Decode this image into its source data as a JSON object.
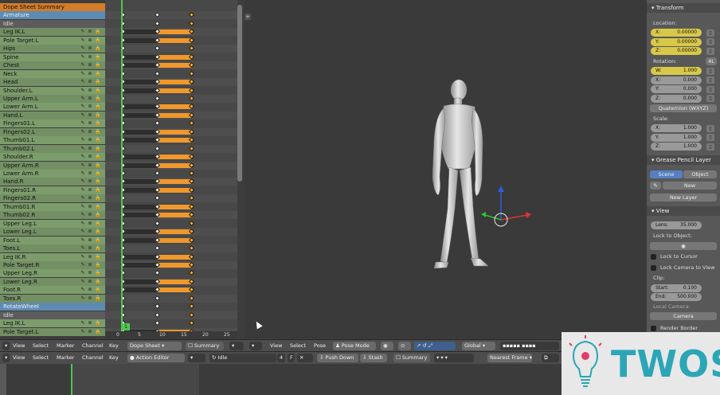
{
  "dopesheet": {
    "summary_label": "Dope Sheet Summary",
    "group_label": "Armature",
    "action1": "Idle",
    "action2": "Idle",
    "group2_label": "RotateWheel",
    "bones1": [
      "Leg IK.L",
      "Pole Target.L",
      "Hips",
      "Spine",
      "Chest",
      "Neck",
      "Head",
      "Shoulder.L",
      "Upper Arm.L",
      "Lower Arm.L",
      "Hand.L",
      "Fingers01.L",
      "Fingers02.L",
      "Thumb01.L",
      "Thumb02.L",
      "Shoulder.R",
      "Upper Arm.R",
      "Lower Arm.R",
      "Hand.R",
      "Fingers01.R",
      "Fingers02.R",
      "Thumb01.R",
      "Thumb02.R",
      "Upper Leg.L",
      "Lower Leg.L",
      "Foot.L",
      "Toes.L",
      "Leg IK.R",
      "Pole Target.R",
      "Upper Leg.R",
      "Lower Leg.R",
      "Foot.R",
      "Toes.R"
    ],
    "bones2": [
      "Leg IK.L",
      "Pole Target.L"
    ],
    "ruler": [
      "0",
      "5",
      "10",
      "15",
      "20",
      "25"
    ],
    "current_frame": "1"
  },
  "properties": {
    "transform_header": "Transform",
    "location_label": "Location:",
    "location": [
      {
        "k": "X:",
        "v": "0.00000"
      },
      {
        "k": "Y:",
        "v": "0.00000"
      },
      {
        "k": "Z:",
        "v": "0.00000"
      }
    ],
    "rotation_label": "Rotation:",
    "rotation_badge": "4L",
    "rotation": [
      {
        "k": "W:",
        "v": "1.000"
      },
      {
        "k": "X:",
        "v": "0.000"
      },
      {
        "k": "Y:",
        "v": "0.000"
      },
      {
        "k": "Z:",
        "v": "0.000"
      }
    ],
    "rotation_mode": "Quaternion (WXYZ)",
    "scale_label": "Scale:",
    "scale": [
      {
        "k": "X:",
        "v": "1.000"
      },
      {
        "k": "Y:",
        "v": "1.000"
      },
      {
        "k": "Z:",
        "v": "1.000"
      }
    ],
    "grease_header": "Grease Pencil Layer",
    "scene_tab": "Scene",
    "object_tab": "Object",
    "new_button": "New",
    "new_layer_button": "New Layer",
    "view_header": "View",
    "lens": {
      "k": "Lens:",
      "v": "35.000"
    },
    "lock_object_label": "Lock to Object:",
    "lock_cursor": "Lock to Cursor",
    "lock_camera": "Lock Camera to View",
    "clip_label": "Clip:",
    "clip_start": {
      "k": "Start:",
      "v": "0.100"
    },
    "clip_end": {
      "k": "End:",
      "v": "500.000"
    },
    "local_camera_label": "Local Camera:",
    "camera_field": "Camera",
    "render_border": "Render Border"
  },
  "header1": {
    "view": "View",
    "select": "Select",
    "marker": "Marker",
    "channel": "Channel",
    "key": "Key",
    "mode": "Dope Sheet",
    "summary": "Summary",
    "view2": "View",
    "select2": "Select",
    "pose": "Pose",
    "pose_mode": "Pose Mode",
    "orientation": "Global"
  },
  "header2": {
    "view": "View",
    "select": "Select",
    "marker": "Marker",
    "channel": "Channel",
    "key": "Key",
    "mode": "Action Editor",
    "action_name": "Idle",
    "users": "4",
    "fake": "F",
    "push_down": "Push Down",
    "stash": "Stash",
    "summary": "Summary",
    "interp": "Nearest Frame"
  },
  "logo": {
    "text": "TWOS"
  }
}
